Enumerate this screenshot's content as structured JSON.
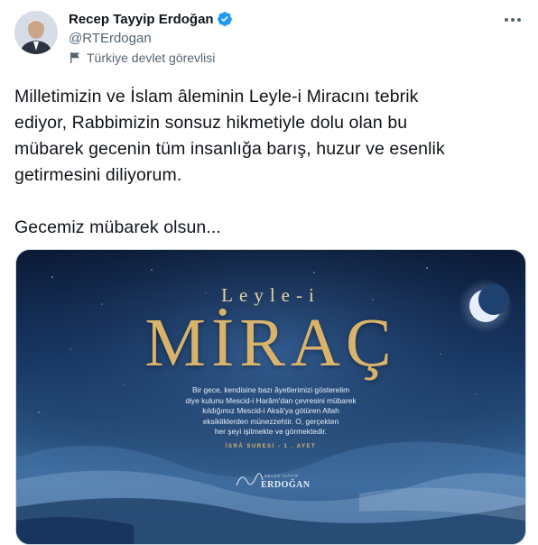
{
  "author": {
    "display_name": "Recep Tayyip Erdoğan",
    "handle": "@RTErdogan",
    "label": "Türkiye devlet görevlisi",
    "verified_color": "#1d9bf0"
  },
  "tweet": {
    "paragraph1": "Milletimizin ve İslam âleminin Leyle-i Miracını tebrik\nediyor, Rabbimizin sonsuz hikmetiyle dolu olan bu\nmübarek gecenin tüm insanlığa barış, huzur ve esenlik\ngetirmesini diliyorum.",
    "paragraph2": "Gecemiz mübarek olsun..."
  },
  "icons": {
    "more": "more-horizontal-icon",
    "verified": "verified-badge-icon",
    "label": "flag-icon"
  },
  "media": {
    "title_small": "Leyle-i",
    "title_big": "MİRAÇ",
    "verse": "Bir gece, kendisine bazı âyetlerimizi gösterelim\ndiye kulunu Mescid-i Harâm'dan çevresini mübarek\nkıldığımız Mescid-i Aksâ'ya götüren Allah\neksikliklerden münezzehtir. O, gerçekten\nher şeyi işitmekte ve görmektedir.",
    "source": "İSRÂ SURESİ - 1 . AYET",
    "signature_small": "RECEP TAYYİP",
    "signature_big": "ERDOĞAN",
    "accent_color": "#d9b36a"
  }
}
